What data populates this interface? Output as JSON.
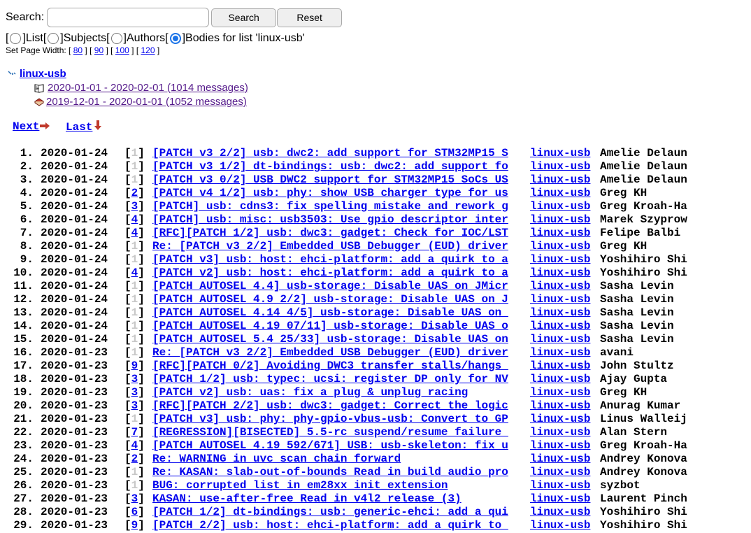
{
  "search": {
    "label": "Search:",
    "value": "",
    "search_button": "Search",
    "reset_button": "Reset"
  },
  "scope": {
    "open": "[",
    "close": "]",
    "options": [
      {
        "label": "List",
        "selected": false
      },
      {
        "label": "Subjects",
        "selected": false
      },
      {
        "label": "Authors",
        "selected": false
      },
      {
        "label": "Bodies for list 'linux-usb'",
        "selected": true
      }
    ]
  },
  "page_width": {
    "label": "Set Page Width:",
    "options": [
      "80",
      "90",
      "100",
      "120"
    ]
  },
  "tree": {
    "root": "linux-usb",
    "items": [
      {
        "label": "2020-01-01 - 2020-02-01 (1014 messages)",
        "icon": "open-folder-icon"
      },
      {
        "label": "2019-12-01 - 2020-01-01 (1052 messages)",
        "icon": "closed-book-icon"
      }
    ]
  },
  "nav": {
    "next": "Next",
    "last": "Last"
  },
  "messages": [
    {
      "num": "1.",
      "date": "2020-01-24",
      "count": "1",
      "subject": "[PATCH v3 2/2] usb: dwc2: add support for STM32MP15 S",
      "list": "linux-usb",
      "author": "Amelie Delaun"
    },
    {
      "num": "2.",
      "date": "2020-01-24",
      "count": "1",
      "subject": "[PATCH v3 1/2] dt-bindings: usb: dwc2: add support fo",
      "list": "linux-usb",
      "author": "Amelie Delaun"
    },
    {
      "num": "3.",
      "date": "2020-01-24",
      "count": "1",
      "subject": "[PATCH v3 0/2] USB DWC2 support for STM32MP15 SoCs US",
      "list": "linux-usb",
      "author": "Amelie Delaun"
    },
    {
      "num": "4.",
      "date": "2020-01-24",
      "count": "2",
      "subject": "[PATCH v4 1/2] usb: phy: show USB charger type for us",
      "list": "linux-usb",
      "author": "Greg KH"
    },
    {
      "num": "5.",
      "date": "2020-01-24",
      "count": "3",
      "subject": "[PATCH] usb: cdns3: fix spelling mistake and rework g",
      "list": "linux-usb",
      "author": "Greg Kroah-Ha"
    },
    {
      "num": "6.",
      "date": "2020-01-24",
      "count": "4",
      "subject": "[PATCH] usb: misc: usb3503: Use gpio descriptor inter",
      "list": "linux-usb",
      "author": "Marek Szyprow"
    },
    {
      "num": "7.",
      "date": "2020-01-24",
      "count": "4",
      "subject": "[RFC][PATCH 1/2] usb: dwc3: gadget: Check for IOC/LST",
      "list": "linux-usb",
      "author": "Felipe Balbi"
    },
    {
      "num": "8.",
      "date": "2020-01-24",
      "count": "1",
      "subject": "Re: [PATCH v3 2/2] Embedded USB Debugger (EUD) driver",
      "list": "linux-usb",
      "author": "Greg KH"
    },
    {
      "num": "9.",
      "date": "2020-01-24",
      "count": "1",
      "subject": "[PATCH v3] usb: host: ehci-platform: add a quirk to a",
      "list": "linux-usb",
      "author": "Yoshihiro Shi"
    },
    {
      "num": "10.",
      "date": "2020-01-24",
      "count": "4",
      "subject": "[PATCH v2] usb: host: ehci-platform: add a quirk to a",
      "list": "linux-usb",
      "author": "Yoshihiro Shi"
    },
    {
      "num": "11.",
      "date": "2020-01-24",
      "count": "1",
      "subject": "[PATCH AUTOSEL 4.4] usb-storage: Disable UAS on JMicr",
      "list": "linux-usb",
      "author": "Sasha Levin"
    },
    {
      "num": "12.",
      "date": "2020-01-24",
      "count": "1",
      "subject": "[PATCH AUTOSEL 4.9 2/2] usb-storage: Disable UAS on J",
      "list": "linux-usb",
      "author": "Sasha Levin"
    },
    {
      "num": "13.",
      "date": "2020-01-24",
      "count": "1",
      "subject": "[PATCH AUTOSEL 4.14 4/5] usb-storage: Disable UAS on ",
      "list": "linux-usb",
      "author": "Sasha Levin"
    },
    {
      "num": "14.",
      "date": "2020-01-24",
      "count": "1",
      "subject": "[PATCH AUTOSEL 4.19 07/11] usb-storage: Disable UAS o",
      "list": "linux-usb",
      "author": "Sasha Levin"
    },
    {
      "num": "15.",
      "date": "2020-01-24",
      "count": "1",
      "subject": "[PATCH AUTOSEL 5.4 25/33] usb-storage: Disable UAS on",
      "list": "linux-usb",
      "author": "Sasha Levin"
    },
    {
      "num": "16.",
      "date": "2020-01-23",
      "count": "1",
      "subject": "Re: [PATCH v3 2/2] Embedded USB Debugger (EUD) driver",
      "list": "linux-usb",
      "author": "avani"
    },
    {
      "num": "17.",
      "date": "2020-01-23",
      "count": "9",
      "subject": "[RFC][PATCH 0/2] Avoiding DWC3 transfer stalls/hangs ",
      "list": "linux-usb",
      "author": "John Stultz"
    },
    {
      "num": "18.",
      "date": "2020-01-23",
      "count": "3",
      "subject": "[PATCH 1/2] usb: typec: ucsi: register DP only for NV",
      "list": "linux-usb",
      "author": "Ajay Gupta"
    },
    {
      "num": "19.",
      "date": "2020-01-23",
      "count": "3",
      "subject": "[PATCH v2] usb: uas: fix a plug & unplug racing",
      "list": "linux-usb",
      "author": "Greg KH"
    },
    {
      "num": "20.",
      "date": "2020-01-23",
      "count": "3",
      "subject": "[RFC][PATCH 2/2] usb: dwc3: gadget: Correct the logic",
      "list": "linux-usb",
      "author": "Anurag Kumar"
    },
    {
      "num": "21.",
      "date": "2020-01-23",
      "count": "1",
      "subject": "[PATCH v3] usb: phy: phy-gpio-vbus-usb: Convert to GP",
      "list": "linux-usb",
      "author": "Linus Walleij"
    },
    {
      "num": "22.",
      "date": "2020-01-23",
      "count": "7",
      "subject": "[REGRESSION][BISECTED] 5.5-rc suspend/resume failure ",
      "list": "linux-usb",
      "author": "Alan Stern"
    },
    {
      "num": "23.",
      "date": "2020-01-23",
      "count": "4",
      "subject": "[PATCH AUTOSEL 4.19 592/671] USB: usb-skeleton: fix u",
      "list": "linux-usb",
      "author": "Greg Kroah-Ha"
    },
    {
      "num": "24.",
      "date": "2020-01-23",
      "count": "2",
      "subject": "Re: WARNING in uvc_scan_chain_forward",
      "list": "linux-usb",
      "author": "Andrey Konova"
    },
    {
      "num": "25.",
      "date": "2020-01-23",
      "count": "1",
      "subject": "Re: KASAN: slab-out-of-bounds Read in build_audio_pro",
      "list": "linux-usb",
      "author": "Andrey Konova"
    },
    {
      "num": "26.",
      "date": "2020-01-23",
      "count": "1",
      "subject": "BUG: corrupted list in em28xx_init_extension",
      "list": "linux-usb",
      "author": "syzbot"
    },
    {
      "num": "27.",
      "date": "2020-01-23",
      "count": "3",
      "subject": "KASAN: use-after-free Read in v4l2_release (3)",
      "list": "linux-usb",
      "author": "Laurent Pinch"
    },
    {
      "num": "28.",
      "date": "2020-01-23",
      "count": "6",
      "subject": "[PATCH 1/2] dt-bindings: usb: generic-ehci: add a qui",
      "list": "linux-usb",
      "author": "Yoshihiro Shi"
    },
    {
      "num": "29.",
      "date": "2020-01-23",
      "count": "9",
      "subject": "[PATCH 2/2] usb: host: ehci-platform: add a quirk to ",
      "list": "linux-usb",
      "author": "Yoshihiro Shi"
    }
  ]
}
